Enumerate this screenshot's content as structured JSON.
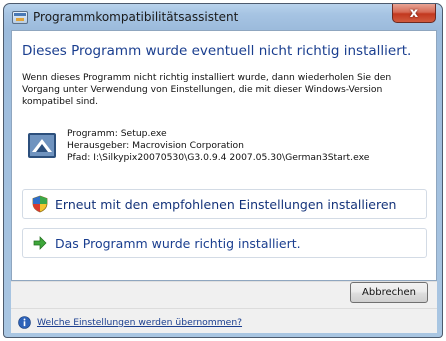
{
  "window": {
    "title": "Programmkompatibilitätsassistent",
    "close_label": "x"
  },
  "content": {
    "heading": "Dieses Programm wurde eventuell nicht richtig installiert.",
    "description": "Wenn dieses Programm nicht richtig installiert wurde, dann wiederholen Sie den Vorgang unter Verwendung von Einstellungen, die mit dieser Windows-Version kompatibel sind.",
    "program_details": {
      "program": "Programm: Setup.exe",
      "publisher": "Herausgeber: Macrovision Corporation",
      "path": "Pfad: I:\\Silkypix20070530\\G3.0.9.4 2007.05.30\\German3Start.exe"
    },
    "options": [
      {
        "label": "Erneut mit den empfohlenen Einstellungen installieren",
        "icon": "shield-icon"
      },
      {
        "label": "Das Programm wurde richtig installiert.",
        "icon": "green-arrow-icon"
      }
    ]
  },
  "footer": {
    "cancel_label": "Abbrechen",
    "help_link": "Welche Einstellungen werden übernommen?"
  },
  "colors": {
    "heading_blue": "#1a3e8f",
    "close_red": "#c2381f",
    "title_bar_blue": "#a6c4e3"
  }
}
